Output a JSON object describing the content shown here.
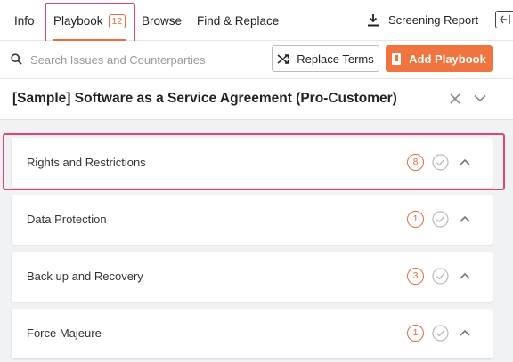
{
  "tabs": [
    {
      "label": "Info"
    },
    {
      "label": "Playbook",
      "count": "12"
    },
    {
      "label": "Browse"
    },
    {
      "label": "Find & Replace"
    }
  ],
  "header": {
    "report_label": "Screening Report",
    "report_icon": "download-icon",
    "collapse_icon": "panel-collapse-icon"
  },
  "toolbar": {
    "search_placeholder": "Search Issues and Counterparties",
    "replace_label": "Replace Terms",
    "add_label": "Add Playbook"
  },
  "document": {
    "title": "[Sample] Software as a Service Agreement (Pro-Customer)"
  },
  "sections": [
    {
      "label": "Rights and Restrictions",
      "issues": "8"
    },
    {
      "label": "Data Protection",
      "issues": "1"
    },
    {
      "label": "Back up and Recovery",
      "issues": "3"
    },
    {
      "label": "Force Majeure",
      "issues": "1"
    }
  ],
  "colors": {
    "accent": "#ee6b3b",
    "highlight": "#e8407a"
  }
}
